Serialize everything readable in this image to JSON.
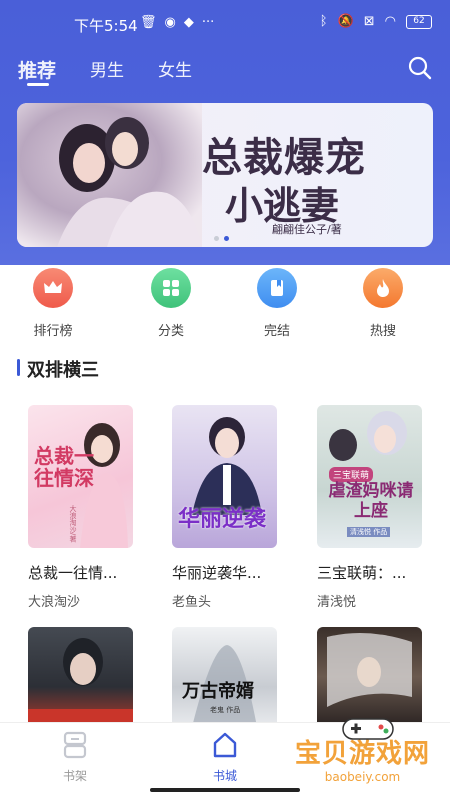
{
  "status_bar": {
    "time": "下午5:54",
    "battery": "62"
  },
  "tabs": [
    {
      "label": "推荐",
      "active": true
    },
    {
      "label": "男生",
      "active": false
    },
    {
      "label": "女生",
      "active": false
    }
  ],
  "banner": {
    "title_line1": "总裁爆宠",
    "title_line2": "小逃妻",
    "author": "翩翩佳公子/著",
    "slide_count": 2,
    "active_slide": 2
  },
  "quick_menu": [
    {
      "label": "排行榜",
      "icon": "crown-icon",
      "color": "#f26b5b"
    },
    {
      "label": "分类",
      "icon": "grid-icon",
      "color": "#4fcf87"
    },
    {
      "label": "完结",
      "icon": "bookmark-icon",
      "color": "#4a9df5"
    },
    {
      "label": "热搜",
      "icon": "fire-icon",
      "color": "#f58a3d"
    }
  ],
  "section": {
    "title": "双排横三"
  },
  "books_row1": [
    {
      "title": "总裁一往情...",
      "author": "大浪淘沙",
      "cover_text": "总裁一往情深",
      "cover_subtext": "大浪淘沙/著"
    },
    {
      "title": "华丽逆袭华...",
      "author": "老鱼头",
      "cover_text": "华丽逆袭"
    },
    {
      "title": "三宝联萌：...",
      "author": "清浅悦",
      "cover_text": "虐渣妈咪请上座",
      "cover_subtext": "三宝联萌",
      "cover_author": "清浅悦 作品"
    }
  ],
  "books_row2": [
    {
      "cover_text": ""
    },
    {
      "cover_text": "万古帝婿",
      "cover_subtext": "老鬼 作品"
    },
    {
      "cover_text": ""
    }
  ],
  "bottom_nav": [
    {
      "label": "书架",
      "active": false
    },
    {
      "label": "书城",
      "active": true
    }
  ],
  "watermark": {
    "text": "宝贝游戏网",
    "url": "baobeiy.com"
  },
  "colors": {
    "primary": "#3b59d6",
    "header": "#4a5fd8"
  }
}
